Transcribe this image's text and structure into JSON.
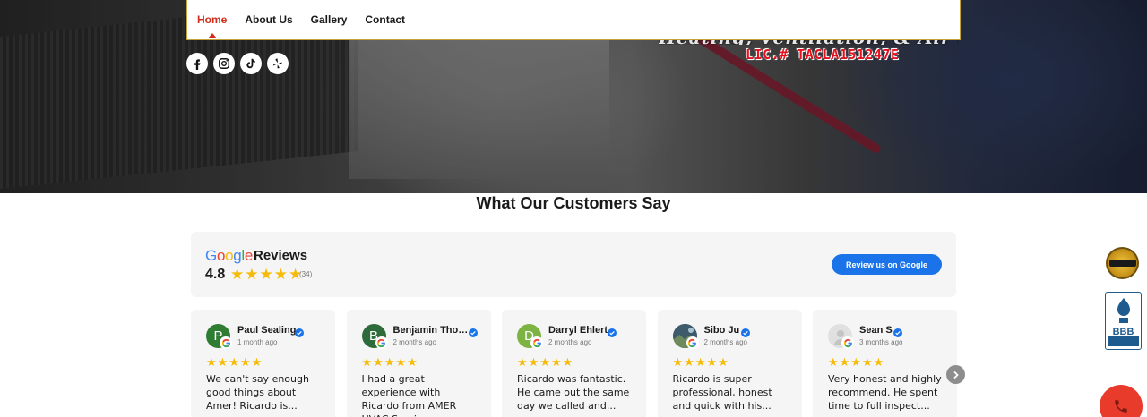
{
  "nav": {
    "items": [
      {
        "label": "Home",
        "active": true
      },
      {
        "label": "About Us"
      },
      {
        "label": "Gallery"
      },
      {
        "label": "Contact"
      }
    ]
  },
  "hero": {
    "tagline": "Heating, Ventilation, & Air Conditioning",
    "license": "LIC.# TACLA151247E"
  },
  "social": [
    "facebook-icon",
    "instagram-icon",
    "tiktok-icon",
    "yelp-icon"
  ],
  "section_title": "What Our Customers Say",
  "reviews_widget": {
    "provider": "Google",
    "title": "Reviews",
    "rating": "4.8",
    "stars": 5,
    "count": "(34)",
    "button_label": "Review us on Google"
  },
  "reviews": [
    {
      "name": "Paul Sealing",
      "initial": "P",
      "avatar_color": "#2e7d32",
      "date": "1 month ago",
      "stars": 5,
      "text": "We can't say enough good things about Amer! Ricardo is..."
    },
    {
      "name": "Benjamin Thompson",
      "initial": "B",
      "avatar_color": "#2e6b3a",
      "date": "2 months ago",
      "stars": 5,
      "text": "I had a great experience with Ricardo from AMER HVAC Service. ..."
    },
    {
      "name": "Darryl Ehlert",
      "initial": "D",
      "avatar_color": "#7cb342",
      "date": "2 months ago",
      "stars": 5,
      "text": "Ricardo was fantastic. He came out the same day we called and..."
    },
    {
      "name": "Sibo Ju",
      "initial": "",
      "avatar_color": "#4a6b7a",
      "date": "2 months ago",
      "stars": 5,
      "text": "Ricardo is super professional, honest and quick with his..."
    },
    {
      "name": "Sean S",
      "initial": "",
      "avatar_color": "#e0e0e0",
      "date": "3 months ago",
      "stars": 5,
      "text": "Very honest and highly recommend. He spent time to full inspect..."
    }
  ],
  "colors": {
    "accent_red": "#d22c1c",
    "google_blue": "#1a73e8",
    "star_gold": "#f6bb06",
    "call_red": "#e93b2b"
  },
  "badges": {
    "bbb_text": "BBB"
  }
}
